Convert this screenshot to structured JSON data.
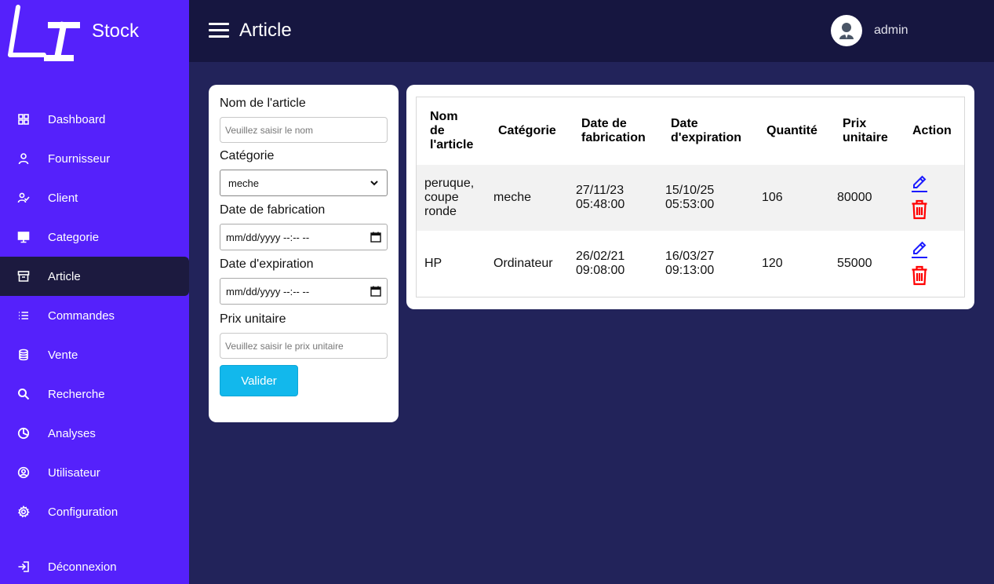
{
  "brand": {
    "logo_text": "LI",
    "name": "Stock"
  },
  "sidebar": {
    "items": [
      {
        "label": "Dashboard",
        "icon": "grid-icon"
      },
      {
        "label": "Fournisseur",
        "icon": "user-icon"
      },
      {
        "label": "Client",
        "icon": "user-check-icon"
      },
      {
        "label": "Categorie",
        "icon": "monitor-icon"
      },
      {
        "label": "Article",
        "icon": "archive-icon",
        "active": true
      },
      {
        "label": "Commandes",
        "icon": "list-icon"
      },
      {
        "label": "Vente",
        "icon": "database-icon"
      },
      {
        "label": "Recherche",
        "icon": "search-icon"
      },
      {
        "label": "Analyses",
        "icon": "pie-chart-icon"
      },
      {
        "label": "Utilisateur",
        "icon": "user-circle-icon"
      },
      {
        "label": "Configuration",
        "icon": "gear-icon"
      }
    ],
    "logout": {
      "label": "Déconnexion",
      "icon": "logout-icon"
    }
  },
  "header": {
    "title": "Article",
    "username": "admin"
  },
  "form": {
    "name_label": "Nom de l'article",
    "name_placeholder": "Veuillez saisir le nom",
    "category_label": "Catégorie",
    "category_value": "meche",
    "fabrication_label": "Date de fabrication",
    "fabrication_value": "mm/dd/yyyy --:-- --",
    "expiration_label": "Date d'expiration",
    "expiration_value": "mm/dd/yyyy --:-- --",
    "price_label": "Prix unitaire",
    "price_placeholder": "Veuillez saisir le prix unitaire",
    "submit_label": "Valider"
  },
  "table": {
    "headers": {
      "name": [
        "Nom",
        "de",
        "l'article"
      ],
      "category": "Catégorie",
      "fabrication": [
        "Date de",
        "fabrication"
      ],
      "expiration": [
        "Date",
        "d'expiration"
      ],
      "quantity": "Quantité",
      "price": [
        "Prix",
        "unitaire"
      ],
      "action": "Action"
    },
    "rows": [
      {
        "name": [
          "peruque,",
          "coupe",
          "ronde"
        ],
        "category": "meche",
        "fabrication": [
          "27/11/23",
          "05:48:00"
        ],
        "expiration": [
          "15/10/25",
          "05:53:00"
        ],
        "quantity": "106",
        "price": "80000"
      },
      {
        "name": [
          "HP"
        ],
        "category": "Ordinateur",
        "fabrication": [
          "26/02/21",
          "09:08:00"
        ],
        "expiration": [
          "16/03/27",
          "09:13:00"
        ],
        "quantity": "120",
        "price": "55000"
      }
    ]
  },
  "colors": {
    "sidebar": "#5521fb",
    "topbar": "#161640",
    "background": "#22235a",
    "active_item": "#1c1a3f",
    "button": "#12b8ec",
    "edit_icon": "#1a1aff",
    "delete_icon": "#ff0000"
  }
}
